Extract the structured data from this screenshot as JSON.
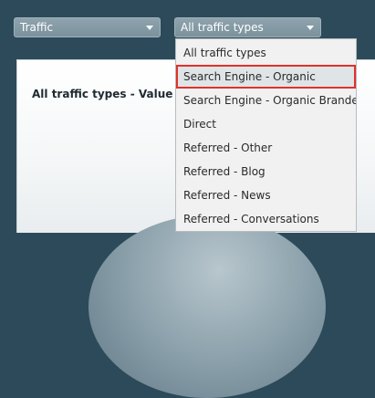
{
  "filters": {
    "traffic_select": "Traffic",
    "type_select": "All traffic types"
  },
  "panel": {
    "title": "All traffic types - Value"
  },
  "dropdown": {
    "items": [
      "All traffic types",
      "Search Engine - Organic",
      "Search Engine - Organic Branded",
      "Direct",
      "Referred - Other",
      "Referred - Blog",
      "Referred - News",
      "Referred - Conversations"
    ],
    "highlighted": "Search Engine - Organic"
  },
  "colors": {
    "background": "#2d4a5a",
    "highlight_border": "#e0322a"
  }
}
